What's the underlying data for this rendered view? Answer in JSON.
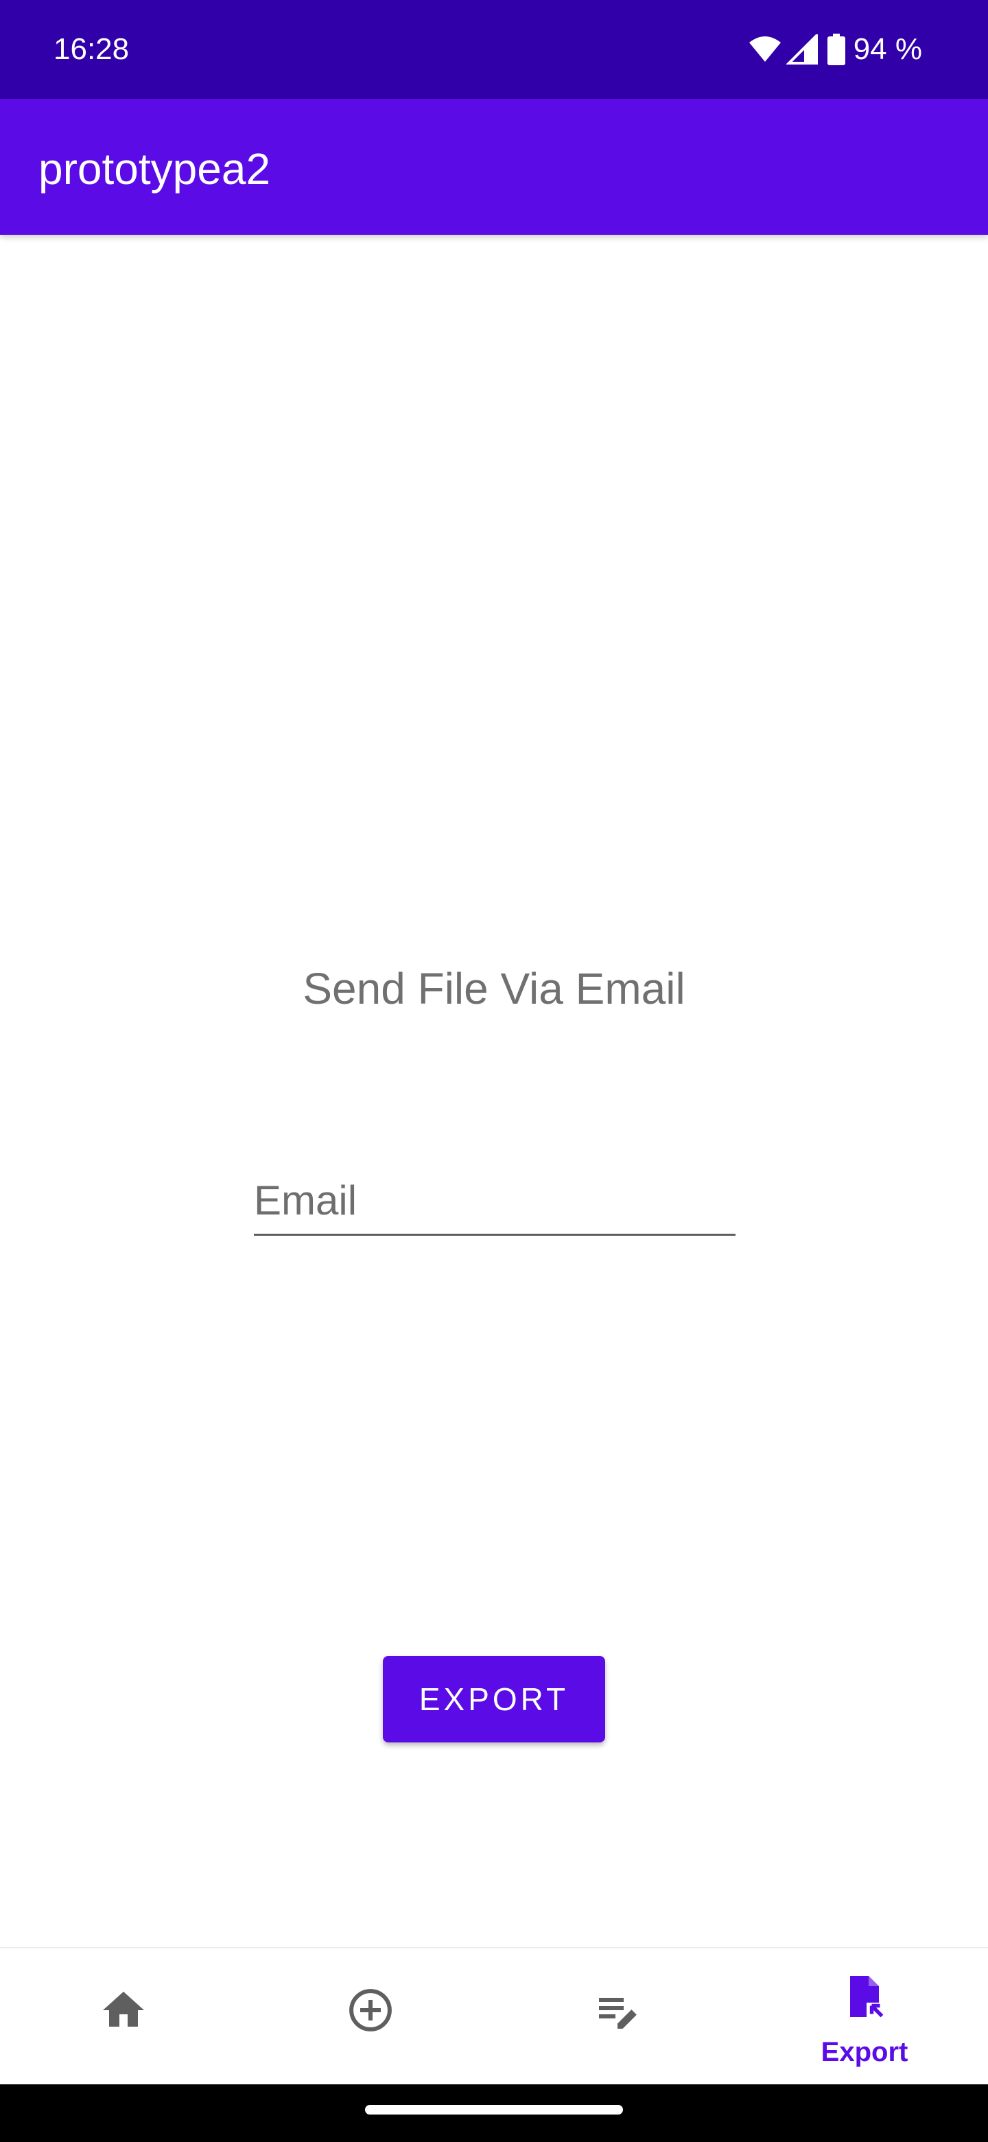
{
  "status_bar": {
    "time": "16:28",
    "battery": "94 %",
    "background": "#3100a8",
    "icons": [
      "wifi-icon",
      "signal-icon",
      "battery-icon"
    ]
  },
  "app_bar": {
    "title": "prototypea2",
    "background": "#5b0be6"
  },
  "main": {
    "heading": "Send File Via Email",
    "email_placeholder": "Email",
    "email_value": "",
    "export_label": "EXPORT"
  },
  "bottom_nav": {
    "items": [
      {
        "icon": "home-icon",
        "label": "",
        "active": false
      },
      {
        "icon": "add-circle-icon",
        "label": "",
        "active": false
      },
      {
        "icon": "edit-list-icon",
        "label": "",
        "active": false
      },
      {
        "icon": "export-file-icon",
        "label": "Export",
        "active": true
      }
    ],
    "active_color": "#5b0be6",
    "inactive_color": "#5f5f5f"
  }
}
